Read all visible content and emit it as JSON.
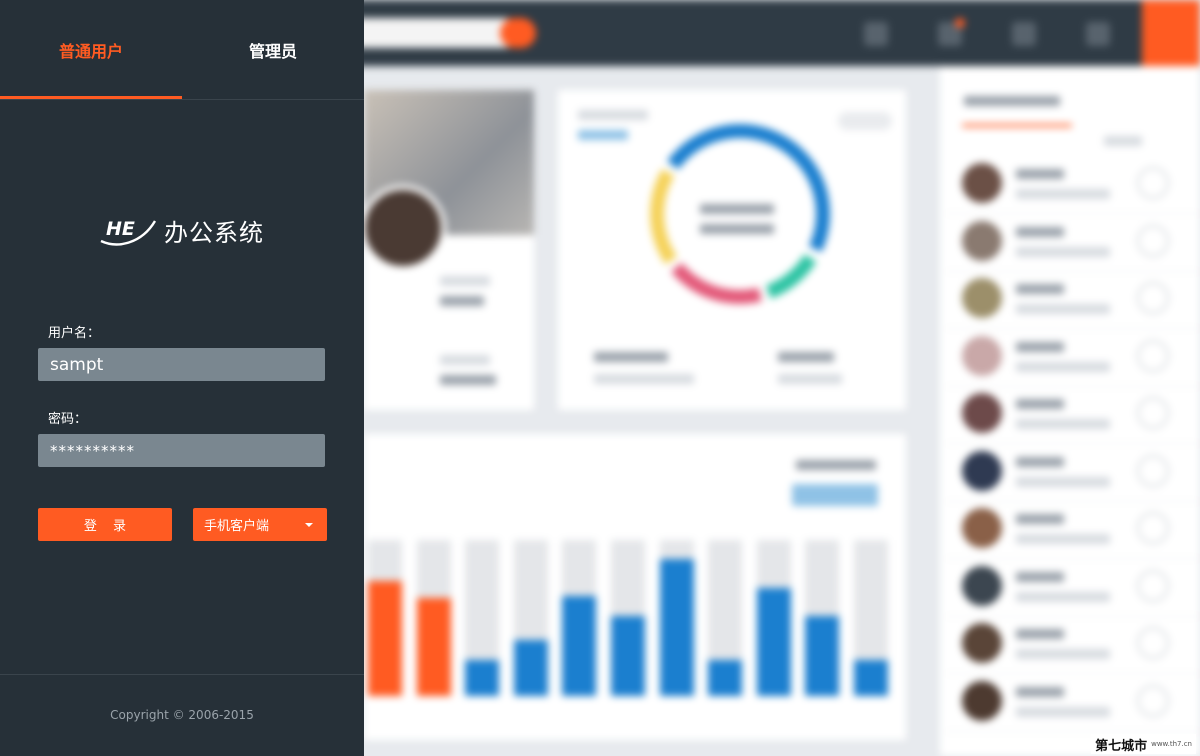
{
  "login": {
    "tabs": [
      {
        "label": "普通用户",
        "active": true
      },
      {
        "label": "管理员",
        "active": false
      }
    ],
    "logo": {
      "mark": "HE",
      "text": "办公系统"
    },
    "username_label": "用户名：",
    "username_value": "sampt",
    "password_label": "密码：",
    "password_value": "**********",
    "login_button": "登 录",
    "mobile_button": "手机客户端",
    "copyright": "Copyright © 2006-2015"
  },
  "watermark": {
    "text": "第七城市",
    "url": "www.th7.cn"
  },
  "colors": {
    "accent": "#ff5b22",
    "panel_bg": "#263038",
    "input_bg": "#7a8790",
    "chart_blue": "#1b7fcf"
  },
  "background_chart": {
    "bars": [
      0.74,
      0.63,
      0.23,
      0.36,
      0.64,
      0.51,
      0.88,
      0.23,
      0.69,
      0.51,
      0.23
    ],
    "highlighted": [
      0,
      1
    ]
  }
}
